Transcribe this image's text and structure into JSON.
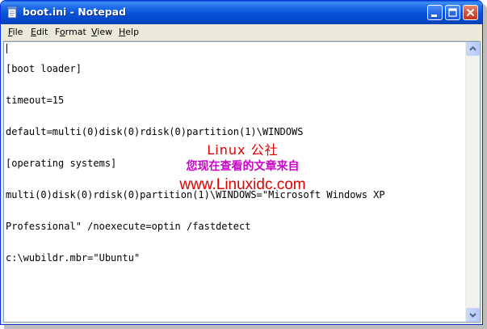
{
  "window": {
    "title": "boot.ini - Notepad",
    "icon": "notepad-icon",
    "title_color": "#ffffff",
    "titlebar_color": "#0551d8",
    "controls": [
      "minimize-icon",
      "maximize-icon",
      "close-icon"
    ]
  },
  "menu": {
    "file": {
      "accel": "F",
      "rest": "ile"
    },
    "edit": {
      "accel": "E",
      "rest": "dit"
    },
    "format": {
      "pre": "F",
      "accel": "o",
      "rest": "rmat"
    },
    "view": {
      "accel": "V",
      "rest": "iew"
    },
    "help": {
      "accel": "H",
      "rest": "elp"
    }
  },
  "editor": {
    "lines": [
      "[boot loader]",
      "timeout=15",
      "default=multi(0)disk(0)rdisk(0)partition(1)\\WINDOWS",
      "[operating systems]",
      "multi(0)disk(0)rdisk(0)partition(1)\\WINDOWS=\"Microsoft Windows XP",
      "Professional\" /noexecute=optin /fastdetect",
      "c:\\wubildr.mbr=\"Ubuntu\""
    ]
  },
  "watermark": {
    "line1": "Linux 公社",
    "line2": "您现在查看的文章来自",
    "line3": "www.Linuxidc.com",
    "red": "#e00000",
    "magenta": "#cc00cc"
  }
}
